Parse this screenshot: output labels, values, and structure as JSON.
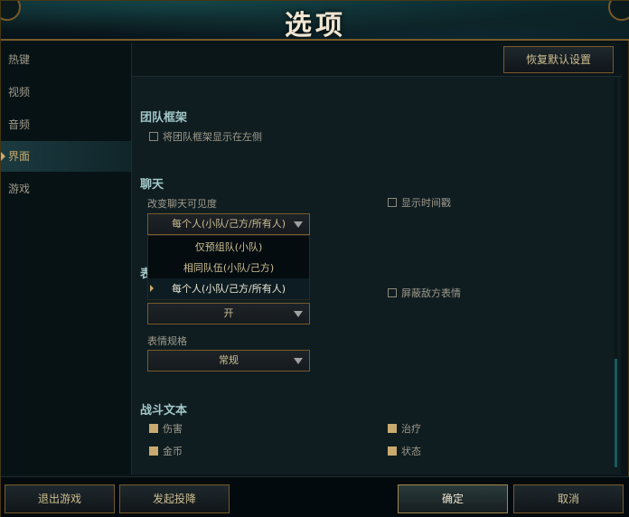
{
  "window": {
    "title": "选项"
  },
  "sidebar": {
    "items": [
      {
        "label": "热键"
      },
      {
        "label": "视频"
      },
      {
        "label": "音频"
      },
      {
        "label": "界面",
        "active": true
      },
      {
        "label": "游戏"
      }
    ]
  },
  "toolbar": {
    "restore_label": "恢复默认设置"
  },
  "team_frames": {
    "title": "团队框架",
    "left_side_label": "将团队框架显示在左侧",
    "left_side_checked": false
  },
  "chat": {
    "title": "聊天",
    "visibility_label": "改变聊天可见度",
    "visibility_value": "每个人(小队/己方/所有人)",
    "visibility_options": [
      "仅预组队(小队)",
      "相同队伍(小队/己方)",
      "每个人(小队/己方/所有人)"
    ],
    "timestamp_label": "显示时间戳",
    "timestamp_checked": false
  },
  "emotes": {
    "title_partial": "表",
    "toggle_value": "开",
    "mute_enemy_label": "屏蔽敌方表情",
    "mute_enemy_checked": false,
    "size_label": "表情规格",
    "size_value": "常规"
  },
  "combat_text": {
    "title": "战斗文本",
    "damage_label": "伤害",
    "damage_checked": true,
    "heal_label": "治疗",
    "heal_checked": true,
    "gold_label": "金币",
    "gold_checked": true,
    "status_label": "状态",
    "status_checked": true
  },
  "footer": {
    "exit_label": "退出游戏",
    "surrender_label": "发起投降",
    "confirm_label": "确定",
    "cancel_label": "取消"
  },
  "colors": {
    "gold": "#c8aa6e",
    "gold_border": "#785a28",
    "section_title": "#a3c7c7",
    "background": "#0f1d21"
  }
}
